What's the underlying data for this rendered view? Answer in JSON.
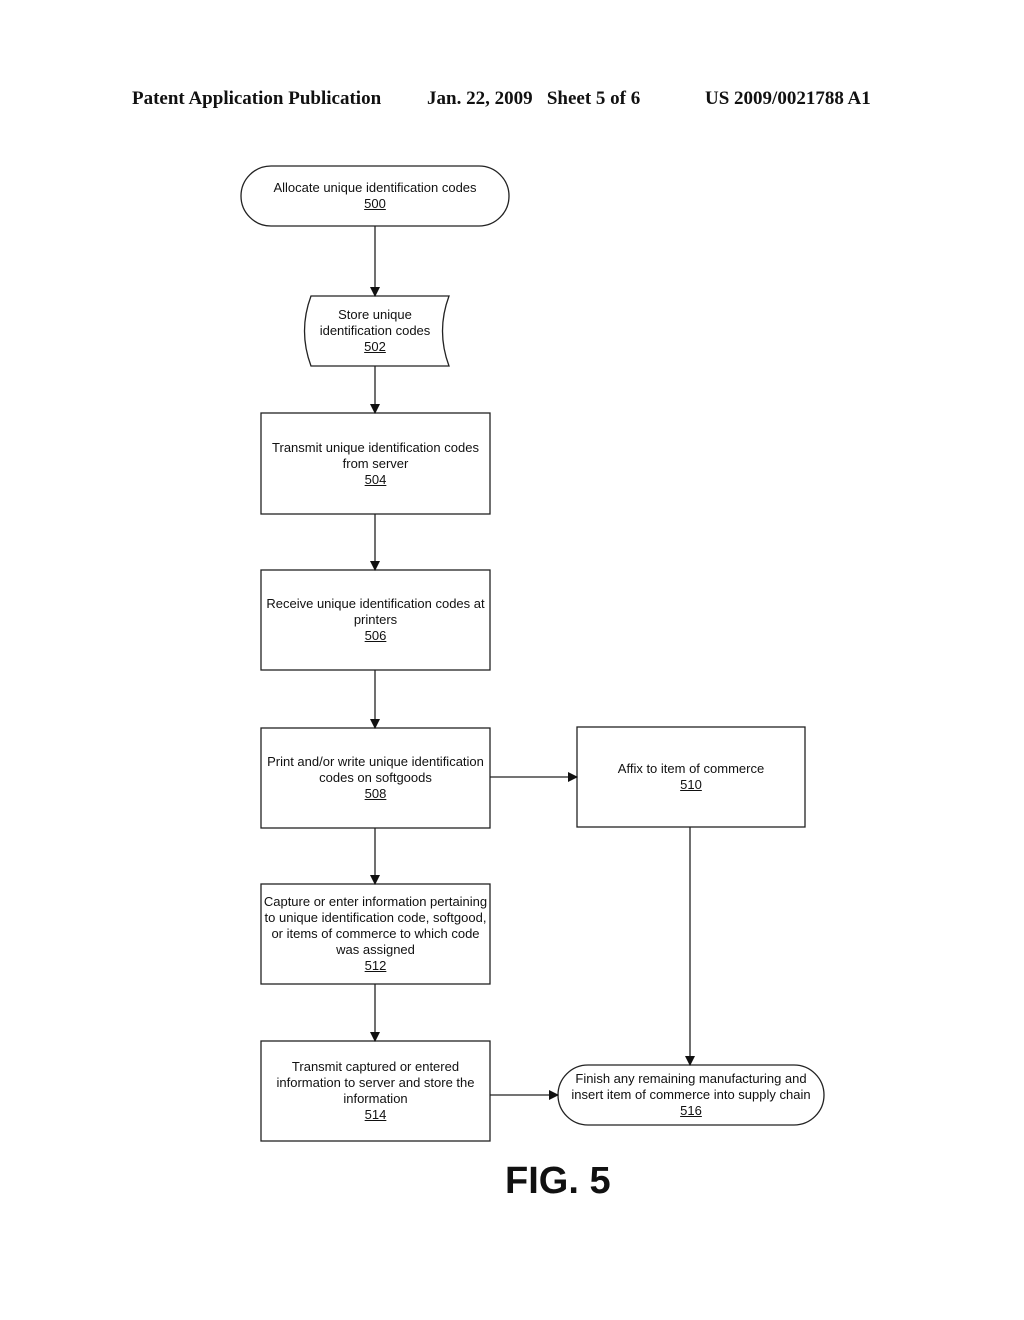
{
  "header": {
    "left": "Patent Application Publication",
    "middle": "Jan. 22, 2009   Sheet 5 of 6",
    "right": "US 2009/0021788 A1"
  },
  "nodes": {
    "n500": {
      "label": "Allocate unique identification codes",
      "ref": "500",
      "shape": "terminator"
    },
    "n502": {
      "label": "Store unique identification codes",
      "ref": "502",
      "shape": "stored-data"
    },
    "n504": {
      "label": "Transmit unique identification codes from server",
      "ref": "504",
      "shape": "process"
    },
    "n506": {
      "label": "Receive unique identification codes at printers",
      "ref": "506",
      "shape": "process"
    },
    "n508": {
      "label": "Print and/or write unique identification codes on softgoods",
      "ref": "508",
      "shape": "process"
    },
    "n510": {
      "label": "Affix to item of commerce",
      "ref": "510",
      "shape": "process"
    },
    "n512": {
      "label": "Capture or enter information pertaining to unique identification code, softgood, or items of commerce to which code was assigned",
      "ref": "512",
      "shape": "process"
    },
    "n514": {
      "label": "Transmit captured or entered information to server and store the information",
      "ref": "514",
      "shape": "process"
    },
    "n516": {
      "label": "Finish any remaining manufacturing and insert item of commerce into supply chain",
      "ref": "516",
      "shape": "terminator"
    }
  },
  "edges": [
    {
      "from": "500",
      "to": "502"
    },
    {
      "from": "502",
      "to": "504"
    },
    {
      "from": "504",
      "to": "506"
    },
    {
      "from": "506",
      "to": "508"
    },
    {
      "from": "508",
      "to": "510"
    },
    {
      "from": "508",
      "to": "512"
    },
    {
      "from": "512",
      "to": "514"
    },
    {
      "from": "510",
      "to": "516"
    },
    {
      "from": "514",
      "to": "516"
    }
  ],
  "figure_label": "FIG. 5"
}
